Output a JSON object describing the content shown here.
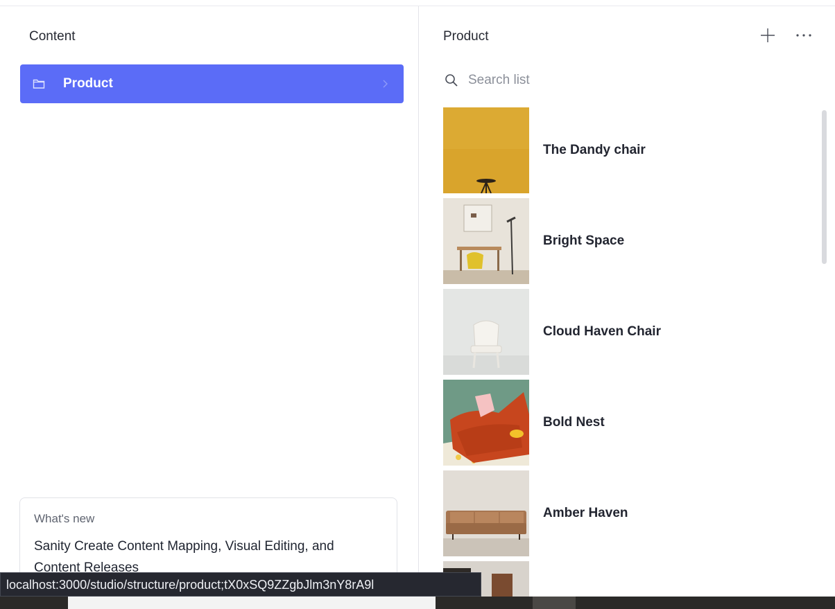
{
  "left_pane": {
    "title": "Content",
    "items": [
      {
        "label": "Product",
        "icon": "folder-icon",
        "selected": true
      }
    ],
    "whats_new": {
      "kicker": "What's new",
      "headline": "Sanity Create Content Mapping, Visual Editing, and Content Releases"
    }
  },
  "right_pane": {
    "title": "Product",
    "search": {
      "placeholder": "Search list",
      "value": ""
    },
    "documents": [
      {
        "title": "The Dandy chair"
      },
      {
        "title": "Bright Space"
      },
      {
        "title": "Cloud Haven Chair"
      },
      {
        "title": "Bold Nest"
      },
      {
        "title": "Amber Haven"
      }
    ]
  },
  "status_bar": {
    "url": "localhost:3000/studio/structure/product;tX0xSQ9ZZgbJlm3nY8rA9l"
  },
  "colors": {
    "accent": "#5b6cf7",
    "tooltip_bg": "#262830"
  }
}
